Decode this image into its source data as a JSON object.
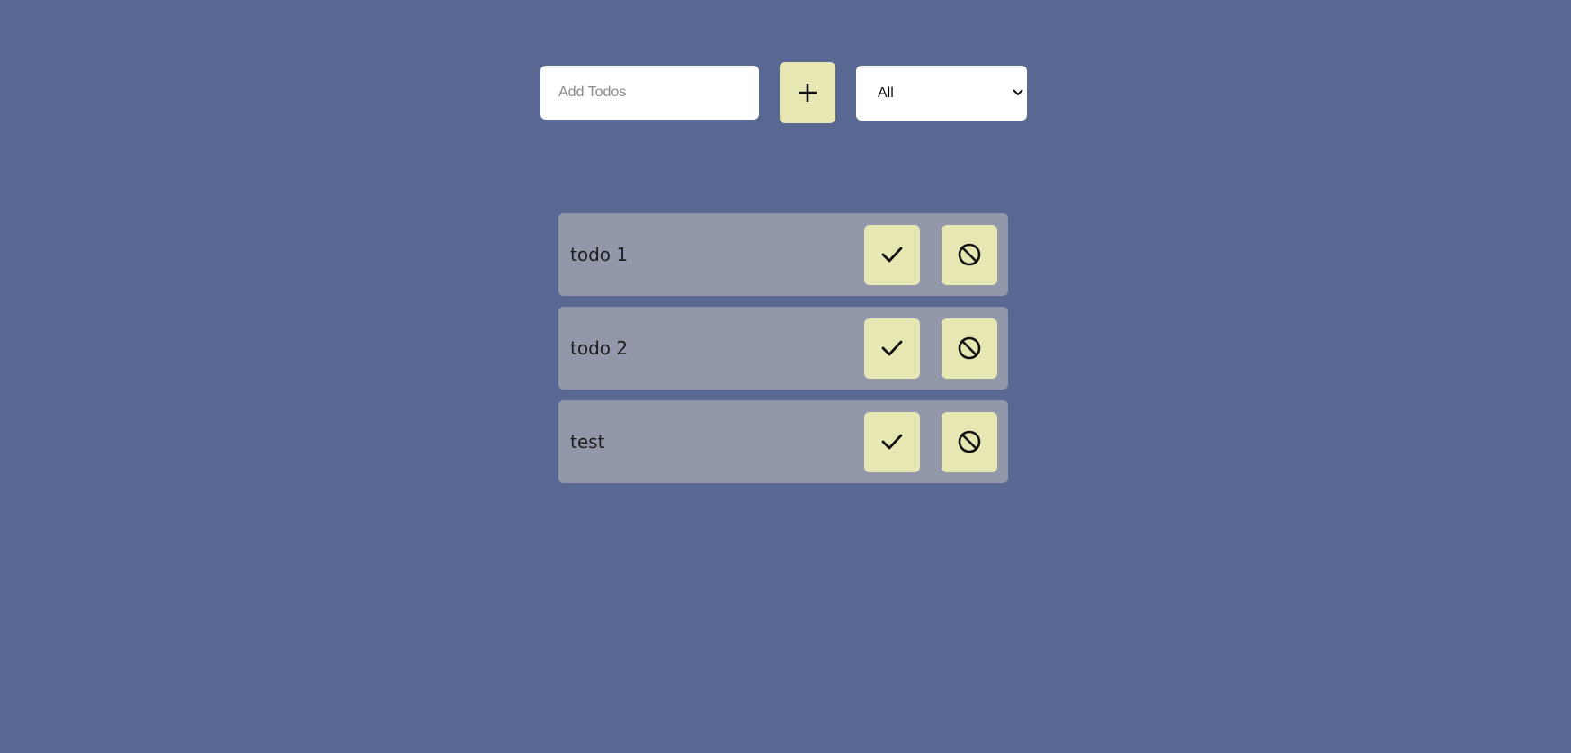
{
  "form": {
    "input_placeholder": "Add Todos",
    "input_value": "",
    "add_icon": "plus-icon",
    "filter": {
      "selected": "All",
      "options": [
        "All"
      ]
    }
  },
  "todos": [
    {
      "text": "todo 1",
      "complete_icon": "check-icon",
      "delete_icon": "ban-icon"
    },
    {
      "text": "todo 2",
      "complete_icon": "check-icon",
      "delete_icon": "ban-icon"
    },
    {
      "text": "test",
      "complete_icon": "check-icon",
      "delete_icon": "ban-icon"
    }
  ],
  "colors": {
    "background": "#596893",
    "item_background": "#9298a9",
    "button_background": "#e6e7b3",
    "field_background": "#ffffff"
  }
}
